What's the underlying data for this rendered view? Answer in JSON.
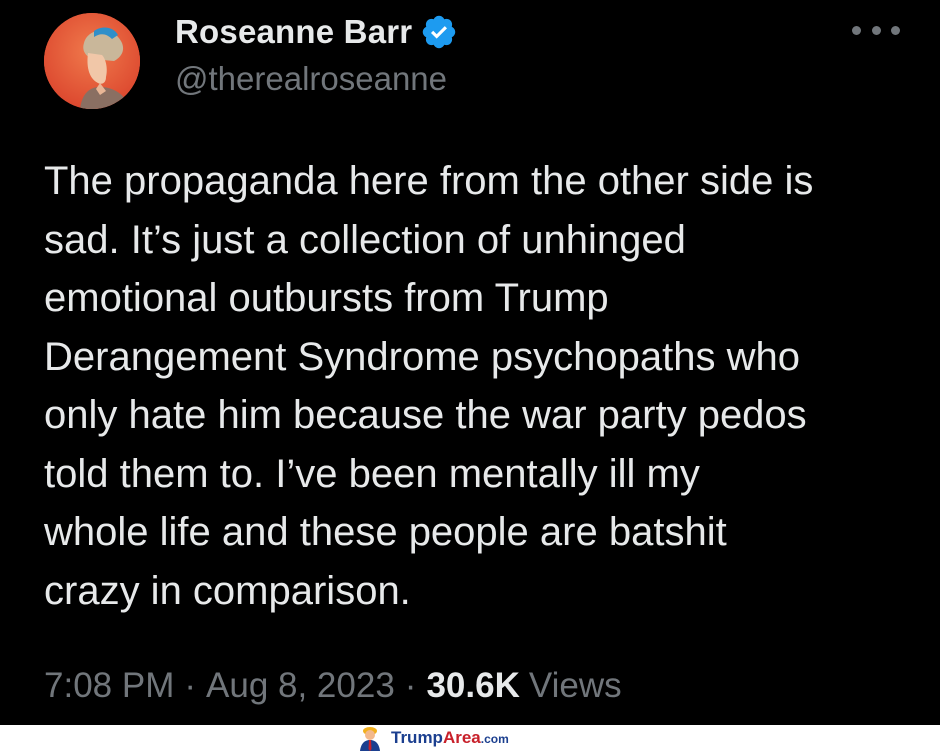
{
  "tweet": {
    "author": {
      "display_name": "Roseanne Barr",
      "handle": "@therealroseanne",
      "verified": true,
      "avatar": "profile-photo"
    },
    "text": "The propaganda here from the other side is\nsad. It’s just a collection of unhinged\nemotional outbursts from Trump\nDerangement Syndrome psychopaths who\nonly hate him because the war party pedos\ntold them to. I’ve been mentally ill my\nwhole life and these people are batshit\ncrazy in comparison.",
    "time": "7:08 PM",
    "separator": "·",
    "date": "Aug 8, 2023",
    "views_count": "30.6K",
    "views_label": "Views"
  },
  "watermark": {
    "brand_part1": "Trump",
    "brand_part2": "Area",
    "brand_tld": ".com"
  },
  "colors": {
    "background": "#000000",
    "primary_text": "#e7e9ea",
    "secondary_text": "#71767b",
    "verified_blue": "#1d9bf0",
    "watermark_blue": "#1b3f8f",
    "watermark_red": "#c8202a"
  },
  "icons": {
    "verified": "verified-badge-icon",
    "more": "more-options-icon"
  }
}
